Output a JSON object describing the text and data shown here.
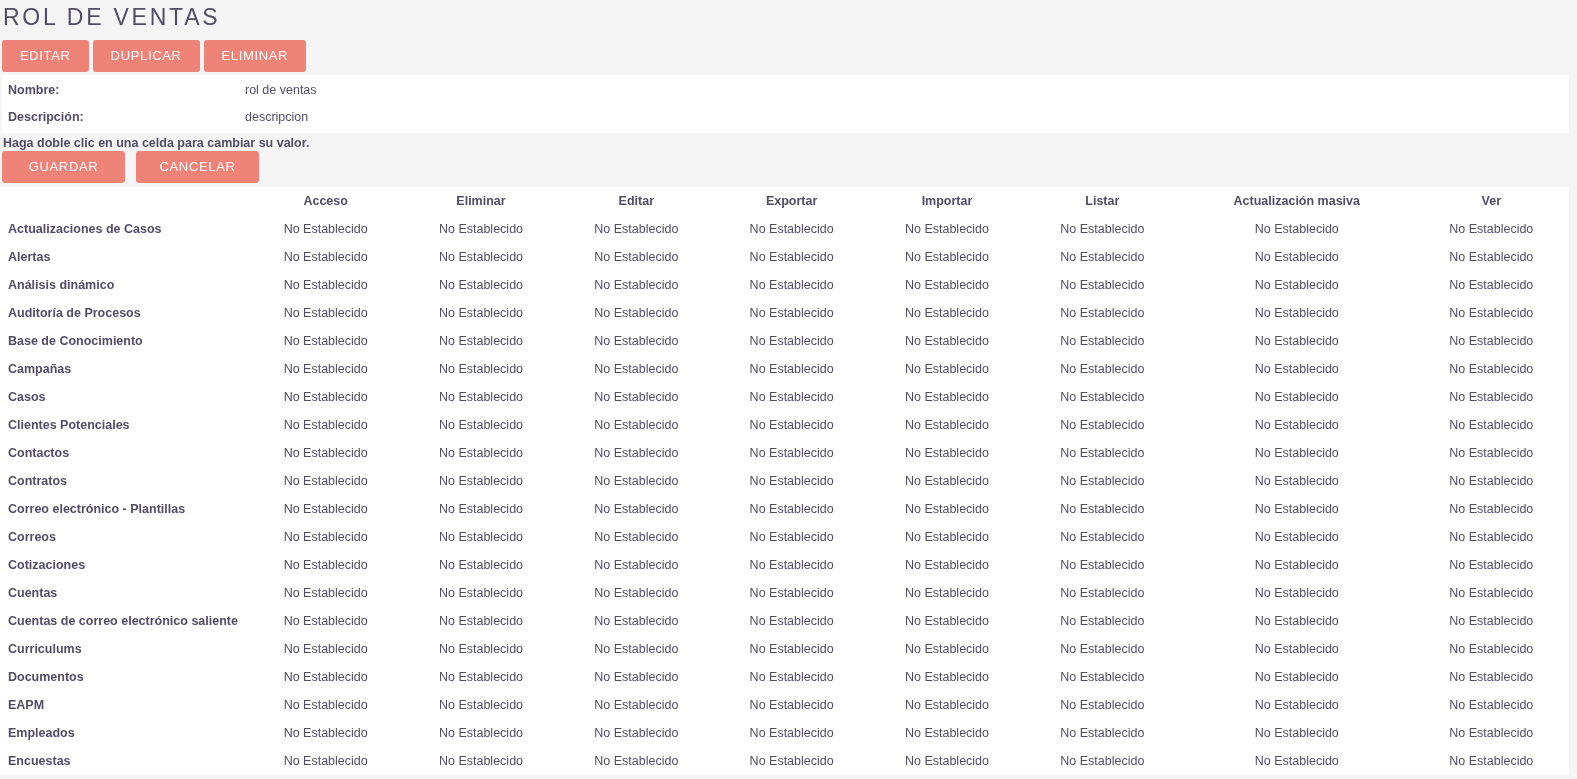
{
  "title": "ROL DE VENTAS",
  "actions": [
    "EDITAR",
    "DUPLICAR",
    "ELIMINAR"
  ],
  "details": [
    {
      "label": "Nombre:",
      "value": "rol de ventas"
    },
    {
      "label": "Descripción:",
      "value": "descripcion"
    }
  ],
  "hint": "Haga doble clic en una celda para cambiar su valor.",
  "form_buttons": [
    "GUARDAR",
    "CANCELAR"
  ],
  "table": {
    "columns": [
      "Acceso",
      "Eliminar",
      "Editar",
      "Exportar",
      "Importar",
      "Listar",
      "Actualización masiva",
      "Ver"
    ],
    "rows": [
      {
        "name": "Actualizaciones de Casos",
        "cells": [
          "No Establecido",
          "No Establecido",
          "No Establecido",
          "No Establecido",
          "No Establecido",
          "No Establecido",
          "No Establecido",
          "No Establecido"
        ]
      },
      {
        "name": "Alertas",
        "cells": [
          "No Establecido",
          "No Establecido",
          "No Establecido",
          "No Establecido",
          "No Establecido",
          "No Establecido",
          "No Establecido",
          "No Establecido"
        ]
      },
      {
        "name": "Análisis dinámico",
        "cells": [
          "No Establecido",
          "No Establecido",
          "No Establecido",
          "No Establecido",
          "No Establecido",
          "No Establecido",
          "No Establecido",
          "No Establecido"
        ]
      },
      {
        "name": "Auditoría de Procesos",
        "cells": [
          "No Establecido",
          "No Establecido",
          "No Establecido",
          "No Establecido",
          "No Establecido",
          "No Establecido",
          "No Establecido",
          "No Establecido"
        ]
      },
      {
        "name": "Base de Conocimiento",
        "cells": [
          "No Establecido",
          "No Establecido",
          "No Establecido",
          "No Establecido",
          "No Establecido",
          "No Establecido",
          "No Establecido",
          "No Establecido"
        ]
      },
      {
        "name": "Campañas",
        "cells": [
          "No Establecido",
          "No Establecido",
          "No Establecido",
          "No Establecido",
          "No Establecido",
          "No Establecido",
          "No Establecido",
          "No Establecido"
        ]
      },
      {
        "name": "Casos",
        "cells": [
          "No Establecido",
          "No Establecido",
          "No Establecido",
          "No Establecido",
          "No Establecido",
          "No Establecido",
          "No Establecido",
          "No Establecido"
        ]
      },
      {
        "name": "Clientes Potenciales",
        "cells": [
          "No Establecido",
          "No Establecido",
          "No Establecido",
          "No Establecido",
          "No Establecido",
          "No Establecido",
          "No Establecido",
          "No Establecido"
        ]
      },
      {
        "name": "Contactos",
        "cells": [
          "No Establecido",
          "No Establecido",
          "No Establecido",
          "No Establecido",
          "No Establecido",
          "No Establecido",
          "No Establecido",
          "No Establecido"
        ]
      },
      {
        "name": "Contratos",
        "cells": [
          "No Establecido",
          "No Establecido",
          "No Establecido",
          "No Establecido",
          "No Establecido",
          "No Establecido",
          "No Establecido",
          "No Establecido"
        ]
      },
      {
        "name": "Correo electrónico - Plantillas",
        "cells": [
          "No Establecido",
          "No Establecido",
          "No Establecido",
          "No Establecido",
          "No Establecido",
          "No Establecido",
          "No Establecido",
          "No Establecido"
        ]
      },
      {
        "name": "Correos",
        "cells": [
          "No Establecido",
          "No Establecido",
          "No Establecido",
          "No Establecido",
          "No Establecido",
          "No Establecido",
          "No Establecido",
          "No Establecido"
        ]
      },
      {
        "name": "Cotizaciones",
        "cells": [
          "No Establecido",
          "No Establecido",
          "No Establecido",
          "No Establecido",
          "No Establecido",
          "No Establecido",
          "No Establecido",
          "No Establecido"
        ]
      },
      {
        "name": "Cuentas",
        "cells": [
          "No Establecido",
          "No Establecido",
          "No Establecido",
          "No Establecido",
          "No Establecido",
          "No Establecido",
          "No Establecido",
          "No Establecido"
        ]
      },
      {
        "name": "Cuentas de correo electrónico saliente",
        "cells": [
          "No Establecido",
          "No Establecido",
          "No Establecido",
          "No Establecido",
          "No Establecido",
          "No Establecido",
          "No Establecido",
          "No Establecido"
        ]
      },
      {
        "name": "Curriculums",
        "cells": [
          "No Establecido",
          "No Establecido",
          "No Establecido",
          "No Establecido",
          "No Establecido",
          "No Establecido",
          "No Establecido",
          "No Establecido"
        ]
      },
      {
        "name": "Documentos",
        "cells": [
          "No Establecido",
          "No Establecido",
          "No Establecido",
          "No Establecido",
          "No Establecido",
          "No Establecido",
          "No Establecido",
          "No Establecido"
        ]
      },
      {
        "name": "EAPM",
        "cells": [
          "No Establecido",
          "No Establecido",
          "No Establecido",
          "No Establecido",
          "No Establecido",
          "No Establecido",
          "No Establecido",
          "No Establecido"
        ]
      },
      {
        "name": "Empleados",
        "cells": [
          "No Establecido",
          "No Establecido",
          "No Establecido",
          "No Establecido",
          "No Establecido",
          "No Establecido",
          "No Establecido",
          "No Establecido"
        ]
      },
      {
        "name": "Encuestas",
        "cells": [
          "No Establecido",
          "No Establecido",
          "No Establecido",
          "No Establecido",
          "No Establecido",
          "No Establecido",
          "No Establecido",
          "No Establecido"
        ]
      }
    ]
  }
}
